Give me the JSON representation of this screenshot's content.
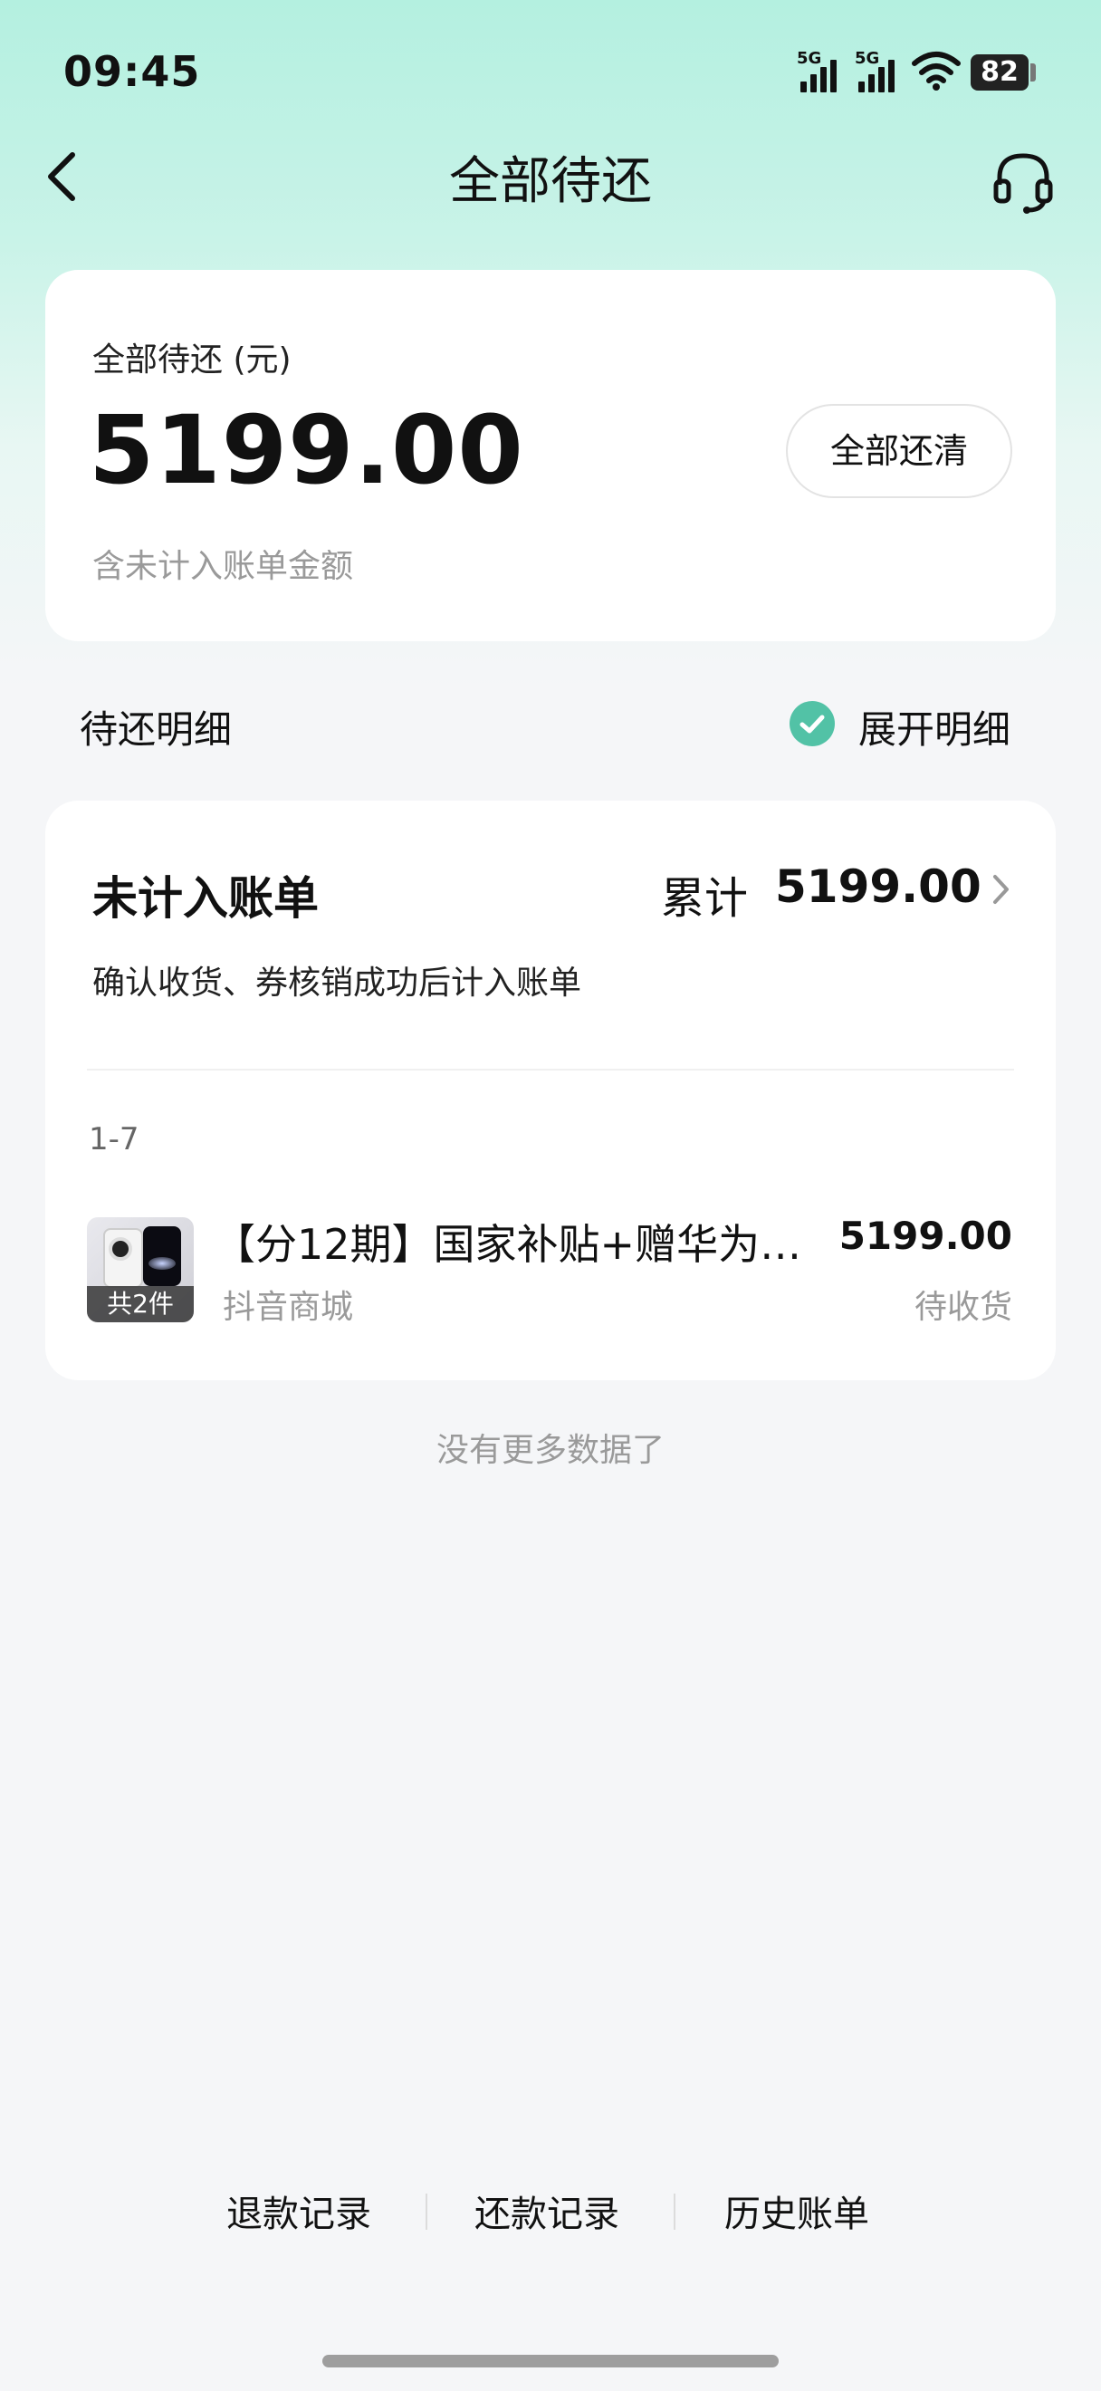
{
  "status_bar": {
    "time": "09:45",
    "sim1_label": "5G",
    "sim2_label": "5G",
    "battery": "82",
    "icons": [
      "signal-icon",
      "signal-icon",
      "wifi-icon",
      "battery-icon"
    ]
  },
  "nav": {
    "title": "全部待还",
    "back_icon": "chevron-left-icon",
    "support_icon": "headset-icon"
  },
  "summary": {
    "label": "全部待还 (元)",
    "amount": "5199.00",
    "note": "含未计入账单金额",
    "payoff_button": "全部还清"
  },
  "details": {
    "title": "待还明细",
    "expand_label": "展开明细",
    "expand_checked": true
  },
  "bill": {
    "title": "未计入账单",
    "cumulative_label": "累计",
    "cumulative_amount": "5199.00",
    "description": "确认收货、券核销成功后计入账单",
    "date_range": "1-7",
    "item": {
      "title": "【分12期】国家补贴+赠华为…",
      "merchant": "抖音商城",
      "price": "5199.00",
      "status": "待收货",
      "badge": "共2件"
    }
  },
  "no_more": "没有更多数据了",
  "bottom_links": [
    "退款记录",
    "还款记录",
    "历史账单"
  ],
  "colors": {
    "accent": "#52c2a6",
    "header_gradient_top": "#b4f0e0",
    "background": "#f5f6f8"
  }
}
